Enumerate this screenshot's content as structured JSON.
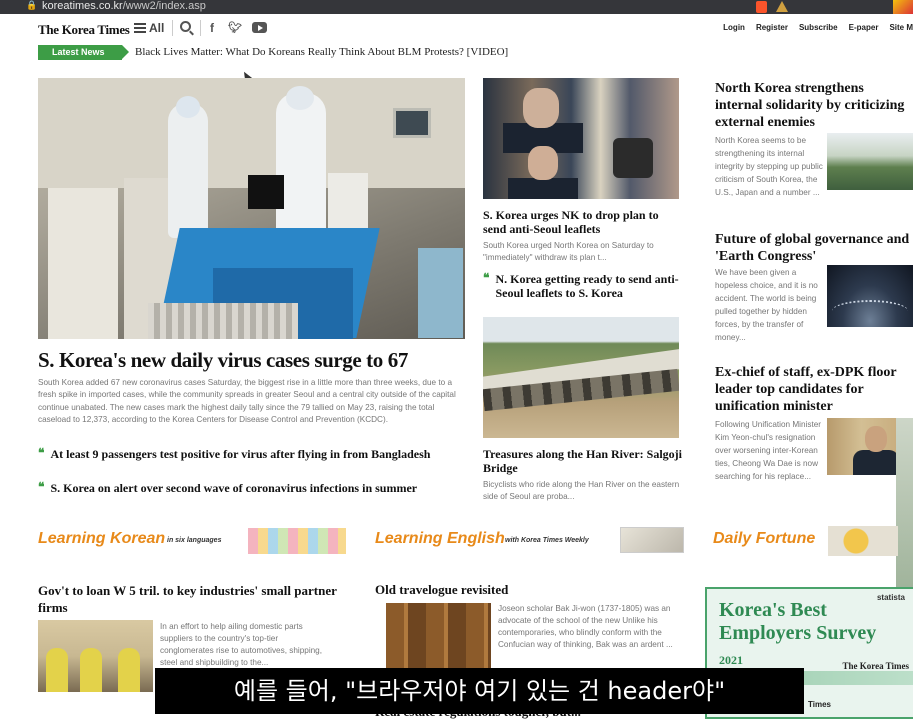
{
  "browser": {
    "url_host": "koreatimes.co.kr",
    "url_path": "/www2/index.asp"
  },
  "header": {
    "logo": "The Korea Times",
    "menu_label": "All",
    "links": [
      "Login",
      "Register",
      "Subscribe",
      "E-paper",
      "Site M"
    ]
  },
  "latest_news": {
    "badge": "Latest News",
    "headline": "Black Lives Matter: What Do Koreans Really Think About BLM Protests? [VIDEO]"
  },
  "main_story": {
    "headline": "S. Korea's new daily virus cases surge to 67",
    "summary": "South Korea added 67 new coronavirus cases Saturday, the biggest rise in a little more than three weeks, due to a fresh spike in imported cases, while the community spreads in greater Seoul and a central city outside of the capital continue unabated. The new cases mark the highest daily tally since the 79 tallied on May 23, raising the total caseload to 12,373, according to the Korea Centers for Disease Control and Prevention (KCDC).",
    "related": [
      "At least 9 passengers test positive for virus after flying in from Bangladesh",
      "S. Korea on alert over second wave of coronavirus infections in summer"
    ]
  },
  "center_column": {
    "story1": {
      "headline": "S. Korea urges NK to drop plan to send anti-Seoul leaflets",
      "summary": "South Korea urged North Korea on Saturday to \"immediately\" withdraw its plan t...",
      "related": "N. Korea getting ready to send anti-Seoul leaflets to S. Korea"
    },
    "story2": {
      "headline": "Treasures along the Han River: Salgoji Bridge",
      "summary": "Bicyclists who ride along the Han River on the eastern side of Seoul are proba..."
    }
  },
  "right_column": {
    "story1": {
      "headline": "North Korea strengthens internal solidarity by criticizing external enemies",
      "summary": "North Korea seems to be strengthening its internal integrity by stepping up public criticism of South Korea, the U.S., Japan and a number ..."
    },
    "story2": {
      "headline": "Future of global governance and 'Earth Congress'",
      "summary": "We have been given a hopeless choice, and it is no accident. The world is being pulled together by hidden forces, by the transfer of money..."
    },
    "story3": {
      "headline": "Ex-chief of staff, ex-DPK floor leader top candidates for unification minister",
      "summary": "Following Unification Minister Kim Yeon-chul's resignation over worsening inter-Korean ties, Cheong Wa Dae is now searching for his replace..."
    }
  },
  "sections": {
    "learning_korean": {
      "title": "Learning Korean",
      "subtitle": "in six languages"
    },
    "learning_english": {
      "title": "Learning English",
      "subtitle": "with Korea Times Weekly"
    },
    "daily_fortune": {
      "title": "Daily Fortune"
    }
  },
  "bottom_stories": {
    "left": {
      "headline": "Gov't to loan W 5 tril. to key industries' small partner firms",
      "summary": "In an effort to help ailing domestic parts suppliers to the country's top-tier conglomerates rise to automotives, shipping, steel and shipbuilding to the..."
    },
    "middle": {
      "headline": "Old travelogue revisited",
      "summary": "Joseon scholar Bak Ji-won (1737-1805) was an advocate of the school of the new Unlike his contemporaries, who blindly conform with the Confucian way of thinking, Bak was an ardent ..."
    },
    "peek": "Real estate regulations tougher, but..."
  },
  "ad": {
    "title_line1": "Korea's Best",
    "title_line2": "Employers Survey",
    "year": "2021",
    "brand": "statista",
    "partner": "The Korea Times",
    "peek": "Times"
  },
  "subtitle": "예를 들어, \"브라우저야 여기 있는 건 header야\""
}
